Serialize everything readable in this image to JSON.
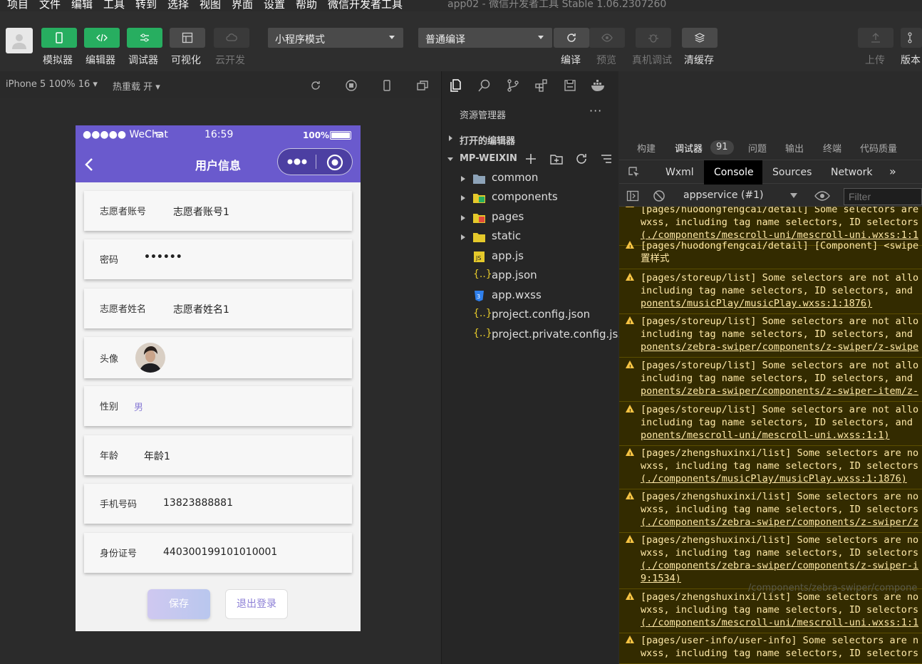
{
  "menubar": {
    "items": [
      "项目",
      "文件",
      "编辑",
      "工具",
      "转到",
      "选择",
      "视图",
      "界面",
      "设置",
      "帮助",
      "微信开发者工具"
    ],
    "title": "app02 - 微信开发者工具 Stable 1.06.2307260"
  },
  "toolbar": {
    "simulator_label": "模拟器",
    "editor_label": "编辑器",
    "debugger_label": "调试器",
    "visual_label": "可视化",
    "cloud_label": "云开发",
    "mode_select": "小程序模式",
    "compile_select": "普通编译",
    "compile_label": "编译",
    "preview_label": "预览",
    "remote_debug_label": "真机调试",
    "clear_cache_label": "清缓存",
    "upload_label": "上传",
    "version_label": "版本"
  },
  "subbar": {
    "device": "iPhone 5 100% 16 ▾",
    "hot_reload": "热重载 开 ▾"
  },
  "phone": {
    "status": {
      "carrier": "●●●●● WeChat",
      "time": "16:59",
      "battery": "100%"
    },
    "nav_title": "用户信息",
    "fields": [
      {
        "label": "志愿者账号",
        "value": "志愿者账号1"
      },
      {
        "label": "密码",
        "value": "••••••"
      },
      {
        "label": "志愿者姓名",
        "value": "志愿者姓名1"
      },
      {
        "label": "头像",
        "value": ""
      },
      {
        "label": "性别",
        "value": "男"
      },
      {
        "label": "年龄",
        "value": "年龄1"
      },
      {
        "label": "手机号码",
        "value": "13823888881"
      },
      {
        "label": "身份证号",
        "value": "440300199101010001"
      }
    ],
    "save_label": "保存",
    "logout_label": "退出登录"
  },
  "explorer": {
    "title": "资源管理器",
    "open_editors": "打开的编辑器",
    "project": "MP-WEIXIN",
    "files": [
      {
        "name": "common",
        "kind": "folder"
      },
      {
        "name": "components",
        "kind": "folder"
      },
      {
        "name": "pages",
        "kind": "folder"
      },
      {
        "name": "static",
        "kind": "folder"
      },
      {
        "name": "app.js",
        "kind": "js"
      },
      {
        "name": "app.json",
        "kind": "json"
      },
      {
        "name": "app.wxss",
        "kind": "css"
      },
      {
        "name": "project.config.json",
        "kind": "json"
      },
      {
        "name": "project.private.config.js...",
        "kind": "json"
      }
    ]
  },
  "devtools": {
    "tabs": [
      "构建",
      "调试器",
      "问题",
      "输出",
      "终端",
      "代码质量"
    ],
    "badge": "91",
    "console_tabs": [
      "Wxml",
      "Console",
      "Sources",
      "Network"
    ],
    "context": "appservice (#1)",
    "filter_placeholder": "Filter",
    "ghost": "/components/zebra-swiper/compone",
    "logs": [
      {
        "lines": [
          "[pages/huodongfengcai/detail] Some selectors are",
          "wxss, including tag name selectors, ID selectors",
          "(./components/mescroll-uni/mescroll-uni.wxss:1:1"
        ]
      },
      {
        "lines": [
          "[pages/huodongfengcai/detail] [Component] <swipe",
          "置样式"
        ]
      },
      {
        "lines": [
          "[pages/storeup/list] Some selectors are not allo",
          "including tag name selectors, ID selectors, and",
          "ponents/musicPlay/musicPlay.wxss:1:1876)"
        ]
      },
      {
        "lines": [
          "[pages/storeup/list] Some selectors are not allo",
          "including tag name selectors, ID selectors, and",
          "ponents/zebra-swiper/components/z-swiper/z-swipe"
        ]
      },
      {
        "lines": [
          "[pages/storeup/list] Some selectors are not allo",
          "including tag name selectors, ID selectors, and",
          "ponents/zebra-swiper/components/z-swiper-item/z-"
        ]
      },
      {
        "lines": [
          "[pages/storeup/list] Some selectors are not allo",
          "including tag name selectors, ID selectors, and",
          "ponents/mescroll-uni/mescroll-uni.wxss:1:1)"
        ]
      },
      {
        "lines": [
          "[pages/zhengshuxinxi/list] Some selectors are no",
          "wxss, including tag name selectors, ID selectors",
          "(./components/musicPlay/musicPlay.wxss:1:1876)"
        ]
      },
      {
        "lines": [
          "[pages/zhengshuxinxi/list] Some selectors are no",
          "wxss, including tag name selectors, ID selectors",
          "(./components/zebra-swiper/components/z-swiper/z"
        ]
      },
      {
        "lines": [
          "[pages/zhengshuxinxi/list] Some selectors are no",
          "wxss, including tag name selectors, ID selectors",
          "(./components/zebra-swiper/components/z-swiper-i",
          "9:1534)"
        ]
      },
      {
        "lines": [
          "[pages/zhengshuxinxi/list] Some selectors are no",
          "wxss, including tag name selectors, ID selectors",
          "(./components/mescroll-uni/mescroll-uni.wxss:1:1"
        ]
      },
      {
        "lines": [
          "[pages/user-info/user-info] Some selectors are n",
          "wxss, including tag name selectors, ID selectors"
        ]
      }
    ]
  },
  "colors": {
    "accent": "#27ae60",
    "nav": "#6a5acd",
    "warn_bg": "#332b00",
    "warn_text": "#ffe9a8"
  }
}
